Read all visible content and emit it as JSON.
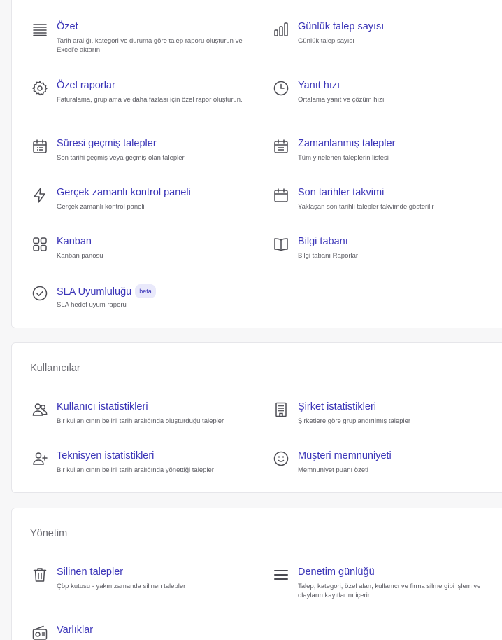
{
  "reports": [
    {
      "title": "Özet",
      "desc": "Tarih aralığı, kategori ve duruma göre talep raporu oluşturun ve Excel'e aktarın",
      "icon": "list-lines-icon"
    },
    {
      "title": "Günlük talep sayısı",
      "desc": "Günlük talep sayısı",
      "icon": "bar-chart-icon"
    },
    {
      "title": "Özel raporlar",
      "desc": "Faturalama, gruplama ve daha fazlası için özel rapor oluşturun.",
      "icon": "gear-icon"
    },
    {
      "title": "Yanıt hızı",
      "desc": "Ortalama yanıt ve çözüm hızı",
      "icon": "clock-icon"
    },
    {
      "title": "Süresi geçmiş talepler",
      "desc": "Son tarihi geçmiş veya geçmiş olan talepler",
      "icon": "calendar-grid-icon"
    },
    {
      "title": "Zamanlanmış talepler",
      "desc": "Tüm yinelenen taleplerin listesi",
      "icon": "calendar-grid-icon"
    },
    {
      "title": "Gerçek zamanlı kontrol paneli",
      "desc": "Gerçek zamanlı kontrol paneli",
      "icon": "lightning-icon"
    },
    {
      "title": "Son tarihler takvimi",
      "desc": "Yaklaşan son tarihli talepler takvimde gösterilir",
      "icon": "calendar-icon"
    },
    {
      "title": "Kanban",
      "desc": "Kanban panosu",
      "icon": "grid-squares-icon"
    },
    {
      "title": "Bilgi tabanı",
      "desc": "Bilgi tabanı Raporlar",
      "icon": "book-icon"
    },
    {
      "title": "SLA Uyumluluğu",
      "badge": "beta",
      "desc": "SLA hedef uyum raporu",
      "icon": "check-circle-icon"
    }
  ],
  "users": {
    "section_title": "Kullanıcılar",
    "items": [
      {
        "title": "Kullanıcı istatistikleri",
        "desc": "Bir kullanıcının belirli tarih aralığında oluşturduğu talepler",
        "icon": "users-icon"
      },
      {
        "title": "Şirket istatistikleri",
        "desc": "Şirketlere göre gruplandırılmış talepler",
        "icon": "building-icon"
      },
      {
        "title": "Teknisyen istatistikleri",
        "desc": "Bir kullanıcının belirli tarih aralığında yönettiği talepler",
        "icon": "user-plus-icon"
      },
      {
        "title": "Müşteri memnuniyeti",
        "desc": "Memnuniyet puanı özeti",
        "icon": "smile-icon"
      }
    ]
  },
  "admin": {
    "section_title": "Yönetim",
    "items": [
      {
        "title": "Silinen talepler",
        "desc": "Çöp kutusu - yakın zamanda silinen talepler",
        "icon": "trash-icon"
      },
      {
        "title": "Denetim günlüğü",
        "desc": "Talep, kategori, özel alan, kullanıcı ve firma silme gibi işlem ve olayların kayıtlarını içerir.",
        "icon": "menu-lines-icon"
      },
      {
        "title": "Varlıklar",
        "desc": "",
        "icon": "radio-device-icon"
      }
    ]
  }
}
